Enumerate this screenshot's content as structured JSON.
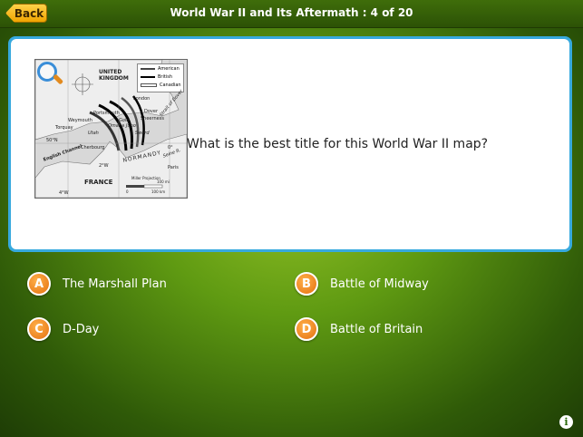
{
  "header": {
    "back_label": "Back",
    "title": "World War II and Its Aftermath : 4 of 20"
  },
  "question": {
    "text": "What is the best title for this World War II map?",
    "map": {
      "legend": [
        "American",
        "British",
        "Canadian"
      ],
      "legend_colors": [
        "#444444",
        "#000000",
        "#ffffff"
      ],
      "labels": {
        "uk": "UNITED\nKINGDOM",
        "london": "London",
        "dover": "Dover",
        "sheerness": "Sheerness",
        "portsmouth": "Portsmouth",
        "weymouth": "Weymouth",
        "torquay": "Torquay",
        "cherbourg": "Cherbourg",
        "utah": "Utah",
        "omaha": "Omaha",
        "gold": "Gold",
        "juno": "Juno",
        "sword": "Sword",
        "strait": "Strait of Dover",
        "channel": "English Channel",
        "normandy": "NORMANDY",
        "france": "FRANCE",
        "paris": "Paris",
        "seine": "Seine R.",
        "lat50": "50°N",
        "lon4": "4°W",
        "lon2": "2°W",
        "lon0": "0°",
        "projection": "Miller Projection",
        "scale_mi": "100 mi",
        "scale_km": "100 km",
        "scale_zero": "0"
      }
    }
  },
  "answers": [
    {
      "letter": "A",
      "text": "The Marshall Plan"
    },
    {
      "letter": "B",
      "text": "Battle of Midway"
    },
    {
      "letter": "C",
      "text": "D-Day"
    },
    {
      "letter": "D",
      "text": "Battle of Britain"
    }
  ],
  "icons": {
    "info": "i",
    "zoom": "magnifier-icon"
  },
  "colors": {
    "accent_orange": "#e4700f",
    "card_border": "#37a9de",
    "back_button": "#f0a400"
  }
}
